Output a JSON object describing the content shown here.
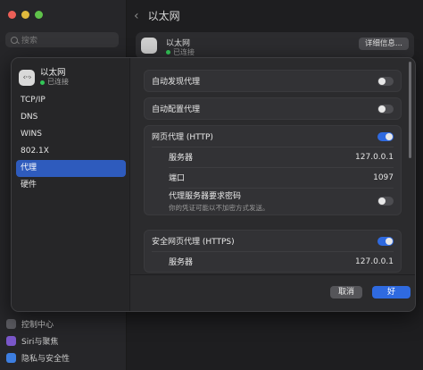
{
  "background": {
    "search_placeholder": "搜索",
    "sidebar_items": [
      "控制中心",
      "Siri与聚焦",
      "隐私与安全性"
    ],
    "header_title": "以太网",
    "back_icon": "chevron-left-icon",
    "service_row": {
      "name": "以太网",
      "status": "已连接",
      "details_button": "详细信息..."
    }
  },
  "dialog": {
    "header": {
      "name": "以太网",
      "status": "已连接",
      "icon": "ethernet-icon"
    },
    "nav": [
      "TCP/IP",
      "DNS",
      "WINS",
      "802.1X",
      "代理",
      "硬件"
    ],
    "active_nav": "代理",
    "cards": {
      "auto_discover": {
        "label": "自动发现代理",
        "enabled": false
      },
      "auto_config": {
        "label": "自动配置代理",
        "enabled": false
      },
      "http": {
        "label": "网页代理 (HTTP)",
        "enabled": true,
        "server_label": "服务器",
        "server_value": "127.0.0.1",
        "port_label": "端口",
        "port_value": "1097",
        "auth_label": "代理服务器要求密码",
        "auth_hint": "你的凭证可能以不加密方式发送。",
        "auth_enabled": false
      },
      "https": {
        "label": "安全网页代理 (HTTPS)",
        "enabled": true,
        "server_label": "服务器",
        "server_value": "127.0.0.1"
      }
    },
    "cancel_button": "取消",
    "ok_button": "好"
  },
  "colors": {
    "accent": "#2f6ae0",
    "active_nav": "#2e5bbd",
    "connected": "#33c758"
  }
}
